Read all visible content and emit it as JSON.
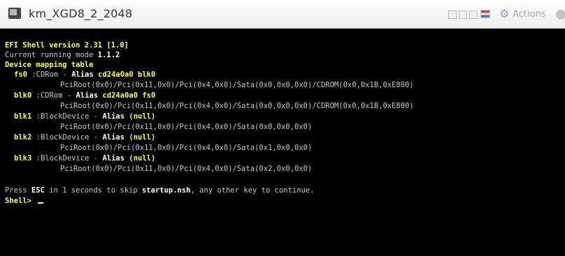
{
  "window": {
    "title": "km_XGD8_2_2048",
    "actions_label": "Actions"
  },
  "console": {
    "version_line": "EFI Shell version 2.31 [1.0]",
    "running_mode_label": "Current running mode ",
    "running_mode_value": "1.1.2",
    "mapping_header": "Device mapping table",
    "mappings": [
      {
        "name": "fs0",
        "type": ":CDRom - ",
        "alias_label": "Alias ",
        "alias_value": "cd24a0a0 blk0",
        "path": "PciRoot(0x0)/Pci(0x11,0x0)/Pci(0x4,0x0)/Sata(0x0,0x0,0x0)/CDROM(0x0,0x1B,0xE800)"
      },
      {
        "name": "blk0",
        "type": ":CDRom - ",
        "alias_label": "Alias ",
        "alias_value": "cd24a0a0 fs0",
        "path": "PciRoot(0x0)/Pci(0x11,0x0)/Pci(0x4,0x0)/Sata(0x0,0x0,0x0)/CDROM(0x0,0x1B,0xE800)"
      },
      {
        "name": "blk1",
        "type": ":BlockDevice - ",
        "alias_label": "Alias ",
        "alias_value": "(null)",
        "path": "PciRoot(0x0)/Pci(0x11,0x0)/Pci(0x4,0x0)/Sata(0x0,0x0,0x0)"
      },
      {
        "name": "blk2",
        "type": ":BlockDevice - ",
        "alias_label": "Alias ",
        "alias_value": "(null)",
        "path": "PciRoot(0x0)/Pci(0x11,0x0)/Pci(0x4,0x0)/Sata(0x1,0x0,0x0)"
      },
      {
        "name": "blk3",
        "type": ":BlockDevice - ",
        "alias_label": "Alias ",
        "alias_value": "(null)",
        "path": "PciRoot(0x0)/Pci(0x11,0x0)/Pci(0x4,0x0)/Sata(0x2,0x0,0x0)"
      }
    ],
    "press_prefix": "Press ",
    "press_key": "ESC",
    "press_middle": " in 1 seconds to skip ",
    "press_file": "startup.nsh",
    "press_suffix": ", any other key to continue.",
    "prompt": "Shell> "
  }
}
